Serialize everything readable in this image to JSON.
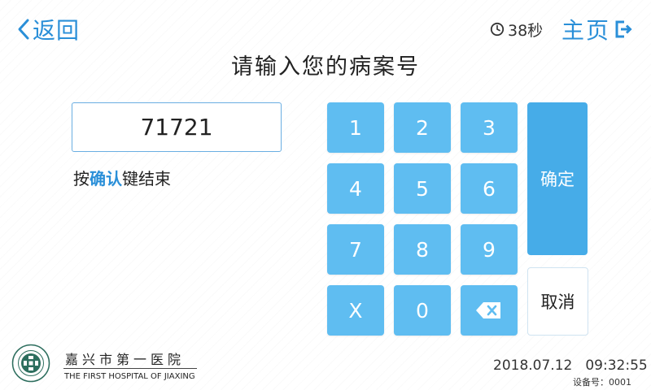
{
  "header": {
    "back_label": "返回",
    "countdown": "38秒",
    "home_label": "主页"
  },
  "title": "请输入您的病案号",
  "input": {
    "value": "71721"
  },
  "hint": {
    "before": "按",
    "highlight": "确认",
    "after": "键结束"
  },
  "keypad": {
    "keys": [
      "1",
      "2",
      "3",
      "4",
      "5",
      "6",
      "7",
      "8",
      "9",
      "X",
      "0"
    ],
    "backspace_icon": "backspace-icon",
    "confirm_label": "确定",
    "cancel_label": "取消"
  },
  "footer": {
    "hospital_cn": "嘉兴市第一医院",
    "hospital_en": "THE FIRST HOSPITAL OF JIAXING",
    "date": "2018.07.12",
    "time": "09:32:55",
    "device": "设备号：0001"
  },
  "colors": {
    "accent": "#2a8fd8",
    "key": "#5fbdf1",
    "confirm": "#46ace8"
  }
}
